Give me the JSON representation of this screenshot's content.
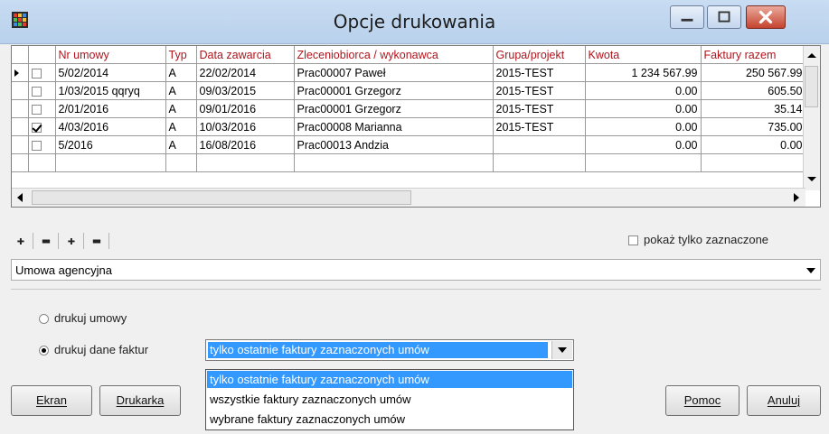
{
  "window": {
    "title": "Opcje drukowania",
    "icon": "app-grid-icon",
    "controls": [
      "minimize-icon",
      "maximize-icon",
      "close-icon"
    ]
  },
  "grid": {
    "columns": [
      "Nr umowy",
      "Typ",
      "Data zawarcia",
      "Zleceniobiorca / wykonawca",
      "Grupa/projekt",
      "Kwota",
      "Faktury razem"
    ],
    "rows": [
      {
        "checked": false,
        "current": true,
        "nr": "5/02/2014",
        "typ": "A",
        "data": "22/02/2014",
        "wykonawca": "Prac00007 Paweł",
        "grupa": "2015-TEST",
        "kwota": "1 234 567.99",
        "faktury": "250 567.99"
      },
      {
        "checked": false,
        "current": false,
        "nr": "1/03/2015 qqryq",
        "typ": "A",
        "data": "09/03/2015",
        "wykonawca": "Prac00001 Grzegorz",
        "grupa": "2015-TEST",
        "kwota": "0.00",
        "faktury": "605.50"
      },
      {
        "checked": false,
        "current": false,
        "nr": "2/01/2016",
        "typ": "A",
        "data": "09/01/2016",
        "wykonawca": "Prac00001 Grzegorz",
        "grupa": "2015-TEST",
        "kwota": "0.00",
        "faktury": "35.14"
      },
      {
        "checked": true,
        "current": false,
        "nr": "4/03/2016",
        "typ": "A",
        "data": "10/03/2016",
        "wykonawca": "Prac00008 Marianna",
        "grupa": "2015-TEST",
        "kwota": "0.00",
        "faktury": "735.00"
      },
      {
        "checked": false,
        "current": false,
        "nr": "5/2016",
        "typ": "A",
        "data": "16/08/2016",
        "wykonawca": "Prac00013 Andzia",
        "grupa": "",
        "kwota": "0.00",
        "faktury": "0.00"
      }
    ]
  },
  "toolbar": {
    "buttons": [
      "add-icon",
      "remove-icon",
      "add-all-icon",
      "remove-all-icon"
    ],
    "show_only_checked_label": "pokaż tylko zaznaczone",
    "show_only_checked": false
  },
  "contract_type": {
    "value": "Umowa agencyjna"
  },
  "print_options": {
    "print_contracts_label": "drukuj umowy",
    "print_invoices_label": "drukuj dane faktur",
    "selected": "drukuj dane faktur",
    "invoice_scope_value": "tylko ostatnie faktury zaznaczonych umów",
    "invoice_scope_options": [
      "tylko ostatnie faktury zaznaczonych umów",
      "wszystkie faktury zaznaczonych umów",
      "wybrane faktury zaznaczonych umów"
    ]
  },
  "buttons": {
    "screen": "Ekran",
    "printer": "Drukarka",
    "help": "Pomoc",
    "cancel": "Anuluj"
  },
  "colors": {
    "header_text": "#b0141c",
    "selection": "#3399ff",
    "close_button": "#c4442e"
  }
}
